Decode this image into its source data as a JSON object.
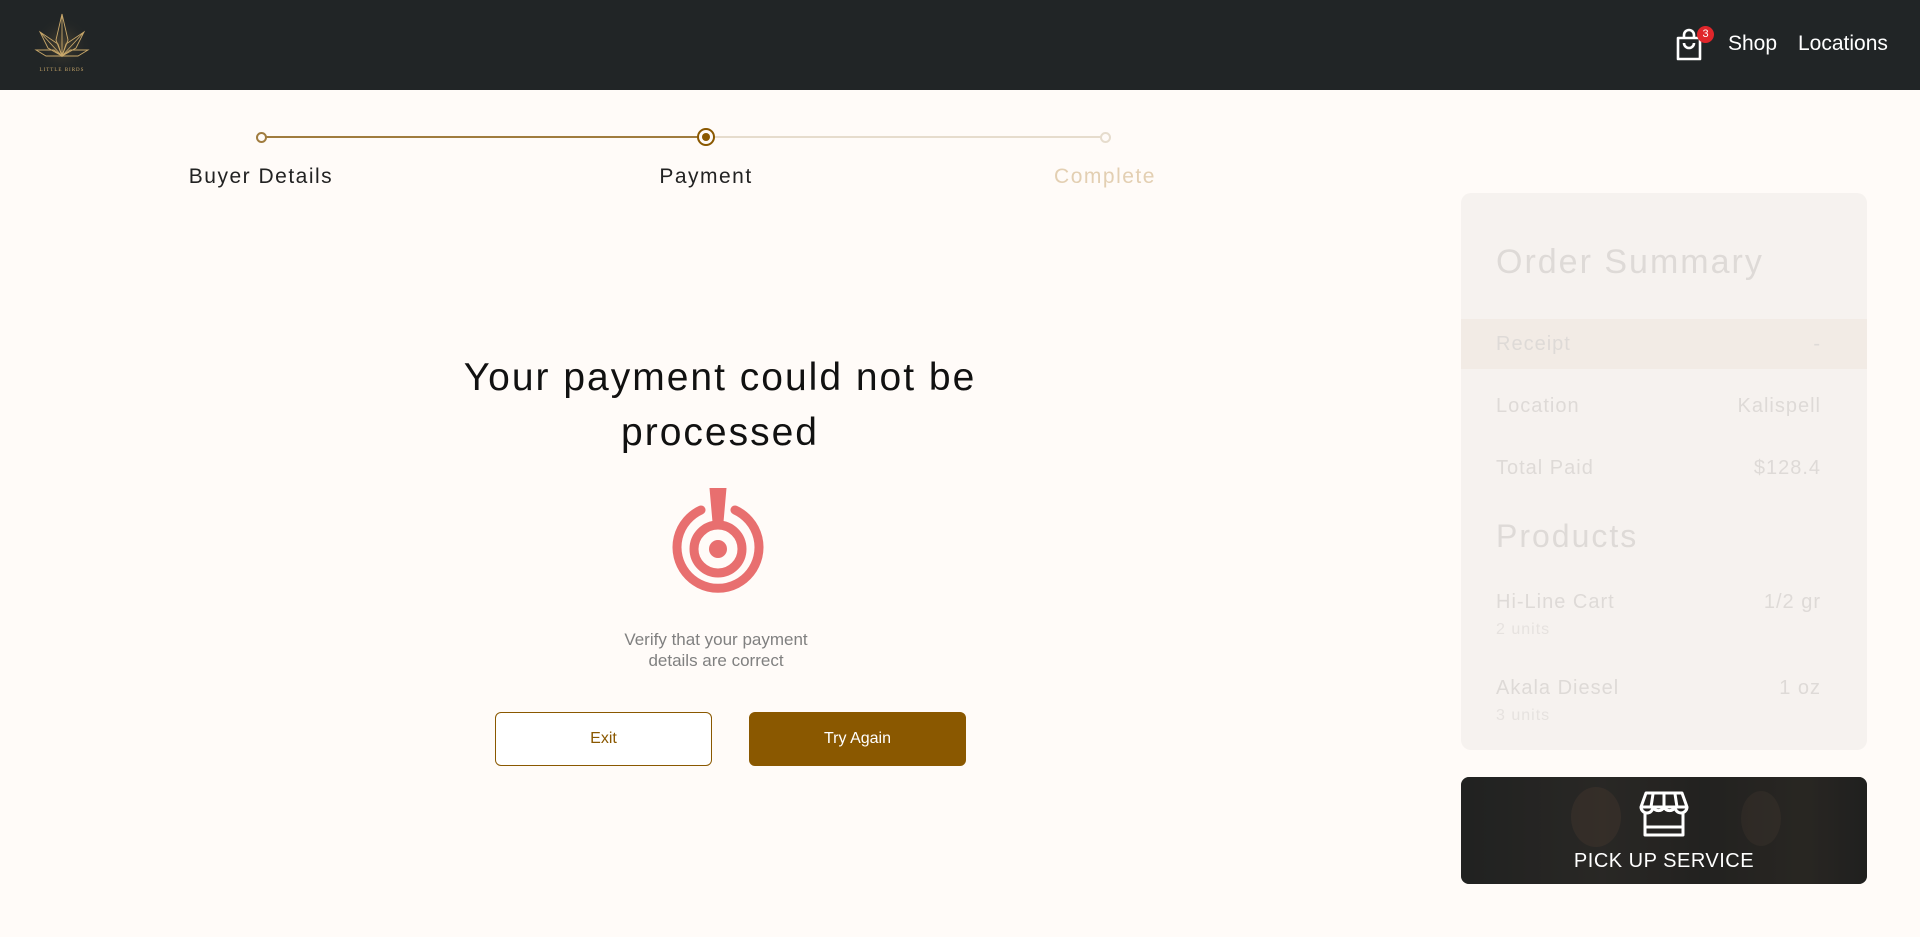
{
  "header": {
    "logo_text": "LITTLE BIRDS",
    "cart_count": "3",
    "nav": {
      "shop": "Shop",
      "locations": "Locations"
    }
  },
  "stepper": {
    "steps": [
      {
        "label": "Buyer Details",
        "state": "done"
      },
      {
        "label": "Payment",
        "state": "current"
      },
      {
        "label": "Complete",
        "state": "todo"
      }
    ]
  },
  "message": {
    "title": "Your payment could not be processed",
    "subtitle": "Verify that your payment details are correct",
    "icon": "alert-target-icon"
  },
  "actions": {
    "exit_label": "Exit",
    "retry_label": "Try Again"
  },
  "order_summary": {
    "title": "Order Summary",
    "receipt": {
      "label": "Receipt",
      "value": "-"
    },
    "location": {
      "label": "Location",
      "value": "Kalispell"
    },
    "total": {
      "label": "Total Paid",
      "value": "$128.4"
    },
    "products_title": "Products",
    "products": [
      {
        "name": "Hi-Line Cart",
        "qty": "1/2 gr",
        "units": "2 units"
      },
      {
        "name": "Akala Diesel",
        "qty": "1 oz",
        "units": "3 units"
      }
    ]
  },
  "pickup": {
    "label": "PICK UP SERVICE",
    "icon": "store-icon"
  },
  "colors": {
    "header_bg": "#212526",
    "accent": "#8a5800",
    "alert": "#e86f6f",
    "page_bg": "#fffbf8"
  }
}
